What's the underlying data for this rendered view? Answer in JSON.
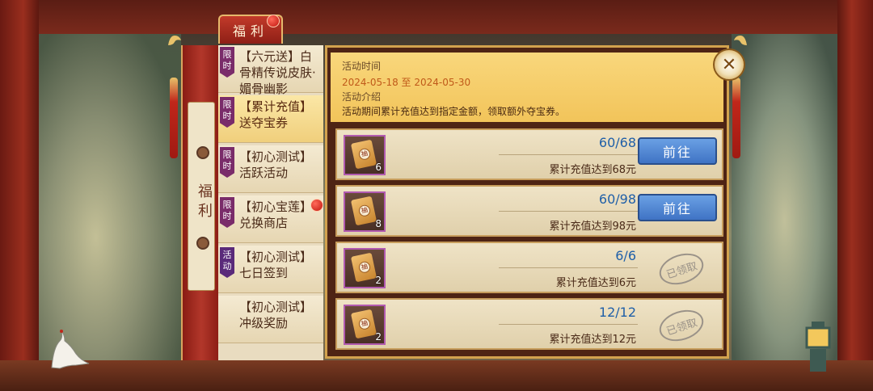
{
  "top_tab": {
    "label": "福利"
  },
  "banner": {
    "title": "福利"
  },
  "event_list": [
    {
      "tag": "限时",
      "title": "【六元送】白骨精传说皮肤·媚骨幽影",
      "active": false
    },
    {
      "tag": "限时",
      "title": "【累计充值】送夺宝券",
      "active": true
    },
    {
      "tag": "限时",
      "title": "【初心测试】活跃活动",
      "active": false
    },
    {
      "tag": "限时",
      "title": "【初心宝莲】兑换商店",
      "active": false,
      "red_dot": true
    },
    {
      "tag": "活动",
      "title": "【初心测试】七日签到",
      "active": false
    },
    {
      "tag": "",
      "title": "【初心测试】冲级奖励",
      "active": false
    }
  ],
  "info": {
    "time_label": "活动时间",
    "date_range": "2024-05-18 至 2024-05-30",
    "intro_label": "活动介绍",
    "intro_text": "活动期间累计充值达到指定金额，领取额外夺宝券。"
  },
  "rewards": [
    {
      "count": "6",
      "progress": "60/68",
      "condition": "累计充值达到68元",
      "status": "go",
      "button_label": "前往"
    },
    {
      "count": "8",
      "progress": "60/98",
      "condition": "累计充值达到98元",
      "status": "go",
      "button_label": "前往"
    },
    {
      "count": "2",
      "progress": "6/6",
      "condition": "累计充值达到6元",
      "status": "claimed",
      "button_label": "已领取"
    },
    {
      "count": "2",
      "progress": "12/12",
      "condition": "累计充值达到12元",
      "status": "claimed",
      "button_label": "已领取"
    }
  ],
  "ticket_glyph": "抽",
  "close_icon_glyph": "✕",
  "colors": {
    "accent_blue": "#3f73c4",
    "progress_blue": "#1f5fa8",
    "date_orange": "#c05a1a",
    "panel_gold": "#f2c45a"
  }
}
